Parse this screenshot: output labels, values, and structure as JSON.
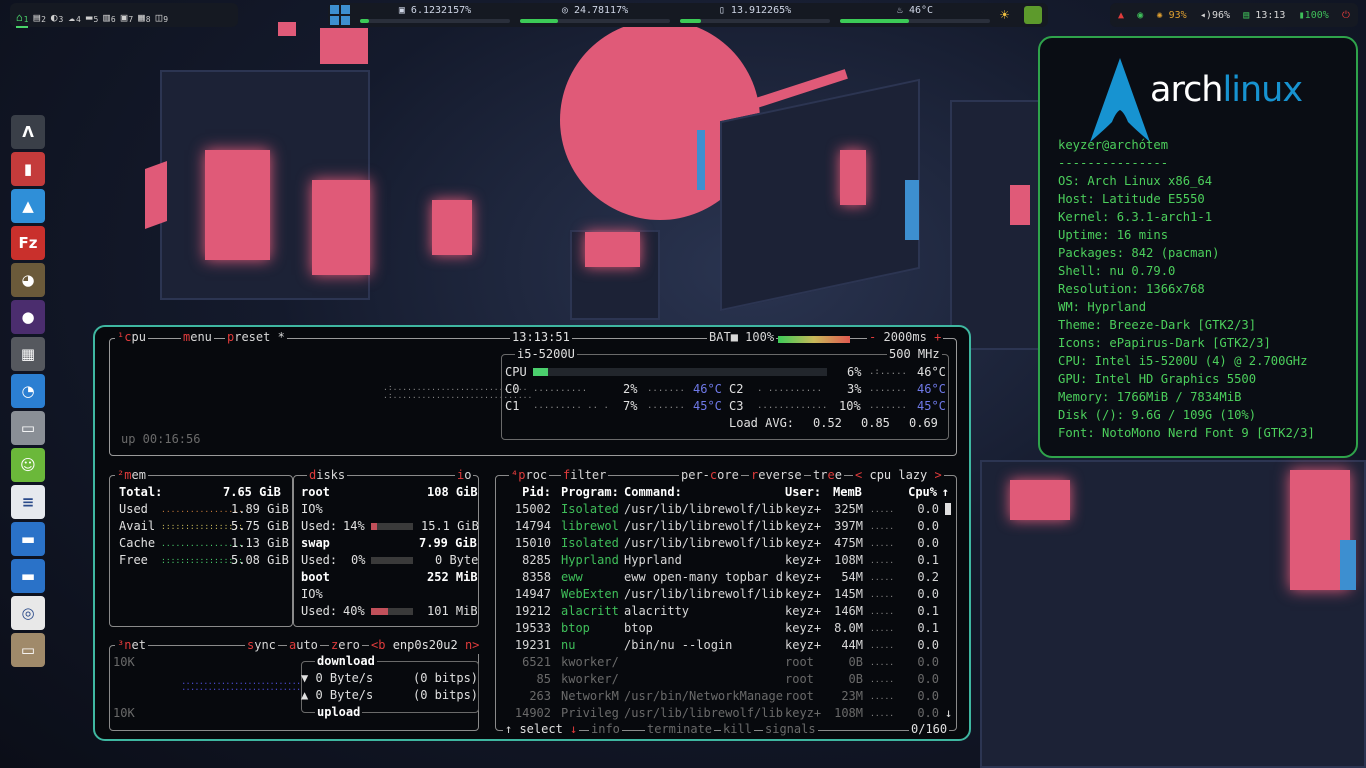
{
  "topbar": {
    "workspaces": [
      {
        "icon": "⌂",
        "num": "1",
        "active": true
      },
      {
        "icon": "▤",
        "num": "2"
      },
      {
        "icon": "◐",
        "num": "3"
      },
      {
        "icon": "☁",
        "num": "4"
      },
      {
        "icon": "▬",
        "num": "5"
      },
      {
        "icon": "▥",
        "num": "6"
      },
      {
        "icon": "▣",
        "num": "7"
      },
      {
        "icon": "▦",
        "num": "8"
      },
      {
        "icon": "◫",
        "num": "9"
      }
    ],
    "resources": [
      {
        "icon": "▣",
        "label": "6.1232157%",
        "fill": 0.06
      },
      {
        "icon": "◎",
        "label": "24.78117%",
        "fill": 0.25
      },
      {
        "icon": "▯",
        "label": "13.912265%",
        "fill": 0.14
      },
      {
        "icon": "♨",
        "label": "46°C",
        "fill": 0.46
      }
    ],
    "status": {
      "warning": "▲",
      "eye": "◉",
      "brightness": "93%",
      "volume": "96%",
      "time": "13:13",
      "battery": "100%"
    }
  },
  "dock": [
    {
      "name": "alacritty",
      "glyph": "Λ",
      "color": "#3a3f48"
    },
    {
      "name": "red-app",
      "glyph": "▮",
      "color": "#c43b3b"
    },
    {
      "name": "triangle-app",
      "glyph": "▲",
      "color": "#2f8fd8"
    },
    {
      "name": "filezilla",
      "glyph": "Fz",
      "color": "#c9302c"
    },
    {
      "name": "gimp",
      "glyph": "◕",
      "color": "#6b5a3a"
    },
    {
      "name": "purple-app",
      "glyph": "●",
      "color": "#4b2d6e"
    },
    {
      "name": "grid-app",
      "glyph": "▦",
      "color": "#55585e"
    },
    {
      "name": "librewolf",
      "glyph": "◔",
      "color": "#2b7fd2"
    },
    {
      "name": "network-app",
      "glyph": "▭",
      "color": "#8a8f96"
    },
    {
      "name": "user-app",
      "glyph": "☺",
      "color": "#6bb83a"
    },
    {
      "name": "text-editor",
      "glyph": "≡",
      "color": "#e6e9ee"
    },
    {
      "name": "window-app-1",
      "glyph": "▬",
      "color": "#2a72c8"
    },
    {
      "name": "window-app-2",
      "glyph": "▬",
      "color": "#2a72c8"
    },
    {
      "name": "settings-app",
      "glyph": "◎",
      "color": "#e8e8e8"
    },
    {
      "name": "tv-app",
      "glyph": "▭",
      "color": "#a08a6a"
    }
  ],
  "neofetch": {
    "logo_arch": "arch",
    "logo_linux": "linux",
    "lines": [
      "keyzer@archótem",
      "---------------",
      "OS: Arch Linux x86_64",
      "Host: Latitude E5550",
      "Kernel: 6.3.1-arch1-1",
      "Uptime: 16 mins",
      "Packages: 842 (pacman)",
      "Shell: nu 0.79.0",
      "Resolution: 1366x768",
      "WM: Hyprland",
      "Theme: Breeze-Dark [GTK2/3]",
      "Icons: ePapirus-Dark [GTK2/3]",
      "CPU: Intel i5-5200U (4) @ 2.700GHz",
      "GPU: Intel HD Graphics 5500",
      "Memory: 1766MiB / 7834MiB",
      "Disk (/): 9.6G / 109G (10%)",
      "Font: NotoMono Nerd Font 9 [GTK2/3]"
    ]
  },
  "btop": {
    "cpu_box": {
      "num": "¹",
      "title": "cpu",
      "menu": "menu",
      "preset": "preset *",
      "clock": "13:13:51",
      "bat_label": "BAT",
      "bat_icon": "■",
      "bat_value": "100%",
      "interval": "2000ms",
      "minus": "-",
      "plus": "+",
      "uptime": "up 00:16:56",
      "cpu_name": "i5-5200U",
      "freq": "500 MHz",
      "total": {
        "label": "CPU",
        "pct": "6%",
        "temp": "46°C",
        "fill": 0.06
      },
      "cores": [
        {
          "label": "C0",
          "pct": "2%",
          "temp": "46°C"
        },
        {
          "label": "C1",
          "pct": "7%",
          "temp": "45°C"
        },
        {
          "label": "C2",
          "pct": "3%",
          "temp": "46°C"
        },
        {
          "label": "C3",
          "pct": "10%",
          "temp": "45°C"
        }
      ],
      "load_label": "Load AVG:",
      "load": [
        "0.52",
        "0.85",
        "0.69"
      ]
    },
    "mem_box": {
      "num": "²",
      "title": "mem",
      "rows": [
        {
          "label": "Total:",
          "value": "7.65 GiB"
        },
        {
          "label": "Used",
          "value": "1.89 GiB"
        },
        {
          "label": "Avail",
          "value": "5.75 GiB"
        },
        {
          "label": "Cache",
          "value": "1.13 GiB"
        },
        {
          "label": "Free",
          "value": "5.08 GiB"
        }
      ]
    },
    "disks_box": {
      "title": "disks",
      "io": "io",
      "disks": [
        {
          "name": "root",
          "size": "108 GiB",
          "io": "IO%",
          "used_label": "Used:",
          "pct": "14%",
          "used": "15.1 GiB",
          "fill": 0.14
        },
        {
          "name": "swap",
          "size": "7.99 GiB",
          "io": "",
          "used_label": "Used:",
          "pct": "0%",
          "used": "0 Byte",
          "fill": 0.0
        },
        {
          "name": "boot",
          "size": "252 MiB",
          "io": "IO%",
          "used_label": "Used:",
          "pct": "40%",
          "used": "101 MiB",
          "fill": 0.4
        }
      ]
    },
    "net_box": {
      "num": "³",
      "title": "net",
      "sync": "sync",
      "auto": "auto",
      "zero": "zero",
      "iface_prev": "<b",
      "iface": "enp0s20u2",
      "iface_next": "n>",
      "scale_top": "10K",
      "scale_bottom": "10K",
      "download": "download",
      "upload": "upload",
      "down_rate": "0 Byte/s",
      "down_bits": "(0 bitps)",
      "up_rate": "0 Byte/s",
      "up_bits": "(0 bitps)"
    },
    "proc_box": {
      "num": "⁴",
      "title": "proc",
      "filter": "filter",
      "per_core": "per-core",
      "reverse": "reverse",
      "tree": "tree",
      "sort": "< cpu lazy >",
      "headers": {
        "pid": "Pid:",
        "program": "Program:",
        "command": "Command:",
        "user": "User:",
        "mem": "MemB",
        "cpu": "Cpu%"
      },
      "rows": [
        {
          "pid": "15002",
          "program": "Isolated",
          "command": "/usr/lib/librewolf/lib",
          "user": "keyz+",
          "mem": "325M",
          "cpu": "0.0"
        },
        {
          "pid": "14794",
          "program": "librewol",
          "command": "/usr/lib/librewolf/lib",
          "user": "keyz+",
          "mem": "397M",
          "cpu": "0.0"
        },
        {
          "pid": "15010",
          "program": "Isolated",
          "command": "/usr/lib/librewolf/lib",
          "user": "keyz+",
          "mem": "475M",
          "cpu": "0.0"
        },
        {
          "pid": "8285",
          "program": "Hyprland",
          "command": "Hyprland",
          "user": "keyz+",
          "mem": "108M",
          "cpu": "0.1"
        },
        {
          "pid": "8358",
          "program": "eww",
          "command": "eww open-many topbar d",
          "user": "keyz+",
          "mem": "54M",
          "cpu": "0.2"
        },
        {
          "pid": "14947",
          "program": "WebExten",
          "command": "/usr/lib/librewolf/lib",
          "user": "keyz+",
          "mem": "145M",
          "cpu": "0.0"
        },
        {
          "pid": "19212",
          "program": "alacritt",
          "command": "alacritty",
          "user": "keyz+",
          "mem": "146M",
          "cpu": "0.1"
        },
        {
          "pid": "19533",
          "program": "btop",
          "command": "btop",
          "user": "keyz+",
          "mem": "8.0M",
          "cpu": "0.1"
        },
        {
          "pid": "19231",
          "program": "nu",
          "command": "/bin/nu --login",
          "user": "keyz+",
          "mem": "44M",
          "cpu": "0.0"
        },
        {
          "pid": "6521",
          "program": "kworker/",
          "command": "",
          "user": "root",
          "mem": "0B",
          "cpu": "0.0"
        },
        {
          "pid": "85",
          "program": "kworker/",
          "command": "",
          "user": "root",
          "mem": "0B",
          "cpu": "0.0"
        },
        {
          "pid": "263",
          "program": "NetworkM",
          "command": "/usr/bin/NetworkManage",
          "user": "root",
          "mem": "23M",
          "cpu": "0.0"
        },
        {
          "pid": "14902",
          "program": "Privileg",
          "command": "/usr/lib/librewolf/lib",
          "user": "keyz+",
          "mem": "108M",
          "cpu": "0.0"
        }
      ],
      "footer": {
        "select": "select",
        "info": "info",
        "terminate": "terminate",
        "kill": "kill",
        "signals": "signals",
        "count": "0/160"
      }
    }
  }
}
